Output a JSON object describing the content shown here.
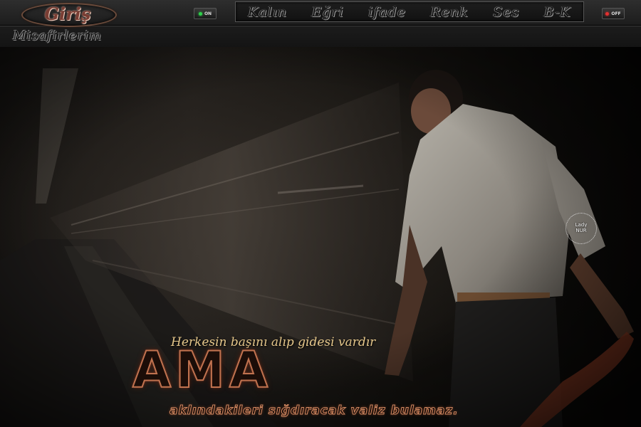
{
  "header": {
    "login_label": "Giriş",
    "guests_label": "Misafirlerim",
    "toggle_on": {
      "label": "ON",
      "color": "#2ed04a"
    },
    "toggle_off": {
      "label": "OFF",
      "color": "#e33030"
    },
    "toolbar": [
      "Kalın",
      "Eğri",
      "ifade",
      "Renk",
      "Ses",
      "B-K"
    ]
  },
  "artwork": {
    "caption_top": "Herkesin başını alıp gidesi vardır",
    "headline": "AMA",
    "caption_bottom": "aklındakileri sığdıracak valiz bulamaz.",
    "stamp_line1": "Lady",
    "stamp_line2": "NUR"
  },
  "colors": {
    "accent_copper": "#c0724f",
    "caption_gold": "#e4c68a",
    "toolbar_bg": "#111111"
  }
}
